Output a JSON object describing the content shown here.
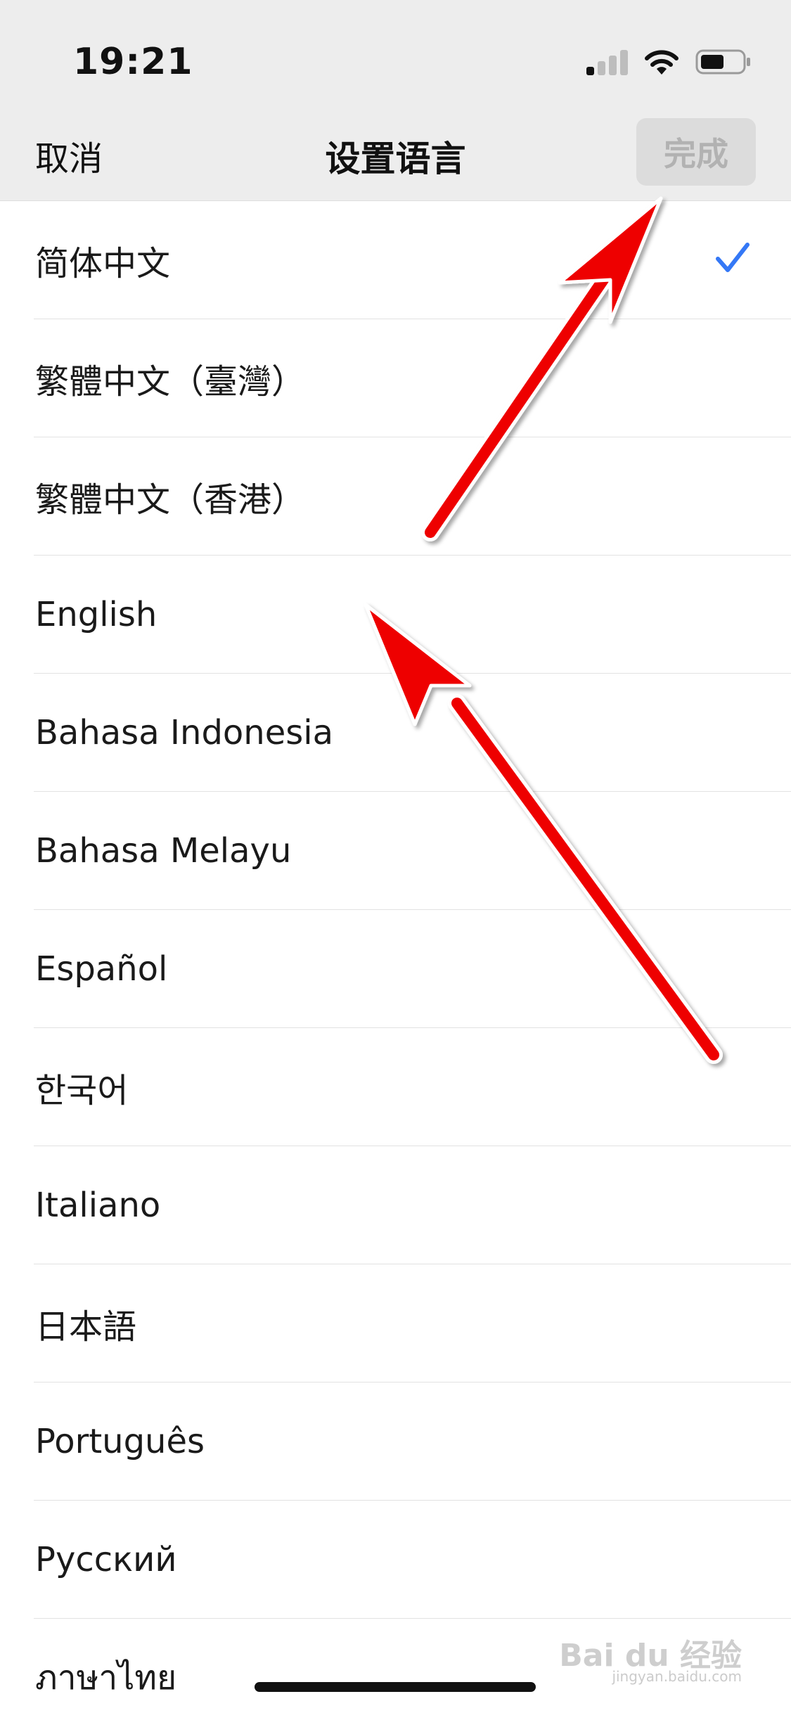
{
  "status_bar": {
    "time": "19:21",
    "icons": [
      "cellular-signal-icon",
      "wifi-icon",
      "battery-icon"
    ]
  },
  "nav": {
    "cancel_label": "取消",
    "title": "设置语言",
    "done_label": "完成"
  },
  "languages": [
    {
      "label": "简体中文",
      "selected": true
    },
    {
      "label": "繁體中文（臺灣）",
      "selected": false
    },
    {
      "label": "繁體中文（香港）",
      "selected": false
    },
    {
      "label": "English",
      "selected": false
    },
    {
      "label": "Bahasa Indonesia",
      "selected": false
    },
    {
      "label": "Bahasa Melayu",
      "selected": false
    },
    {
      "label": "Español",
      "selected": false
    },
    {
      "label": "한국어",
      "selected": false
    },
    {
      "label": "Italiano",
      "selected": false
    },
    {
      "label": "日本語",
      "selected": false
    },
    {
      "label": "Português",
      "selected": false
    },
    {
      "label": "Русский",
      "selected": false
    },
    {
      "label": "ภาษาไทย",
      "selected": false
    }
  ],
  "watermark": {
    "brand": "Bai du 经验",
    "url": "jingyan.baidu.com"
  },
  "colors": {
    "accent": "#3478f6",
    "nav_background": "#ededed",
    "done_disabled_bg": "#dcdcdc",
    "done_disabled_text": "#b2b2b2",
    "annotation_arrow": "#ee0000"
  }
}
